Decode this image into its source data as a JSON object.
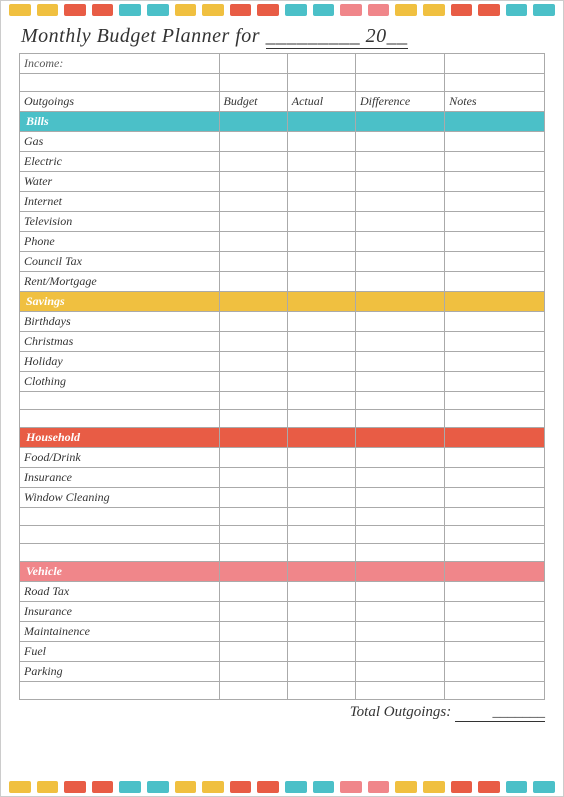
{
  "title": {
    "prefix": "Monthly Budget Planner for",
    "month_line": "_________ 20__"
  },
  "deco_colors_top": [
    "#f0c040",
    "#f0c040",
    "#e85c45",
    "#e85c45",
    "#4bc0c8",
    "#4bc0c8",
    "#f0c040",
    "#f0c040",
    "#e85c45",
    "#e85c45",
    "#4bc0c8",
    "#4bc0c8",
    "#f0868a",
    "#f0868a",
    "#f0c040",
    "#f0c040",
    "#e85c45",
    "#e85c45",
    "#4bc0c8",
    "#4bc0c8"
  ],
  "deco_colors_bottom": [
    "#f0c040",
    "#f0c040",
    "#e85c45",
    "#e85c45",
    "#4bc0c8",
    "#4bc0c8",
    "#f0c040",
    "#f0c040",
    "#e85c45",
    "#e85c45",
    "#4bc0c8",
    "#4bc0c8",
    "#f0868a",
    "#f0868a",
    "#f0c040",
    "#f0c040",
    "#e85c45",
    "#e85c45",
    "#4bc0c8",
    "#4bc0c8"
  ],
  "income_label": "Income:",
  "headers": {
    "outgoings": "Outgoings",
    "budget": "Budget",
    "actual": "Actual",
    "difference": "Difference",
    "notes": "Notes"
  },
  "sections": {
    "bills": {
      "label": "Bills",
      "items": [
        "Gas",
        "Electric",
        "Water",
        "Internet",
        "Television",
        "Phone",
        "Council Tax",
        "Rent/Mortgage"
      ]
    },
    "savings": {
      "label": "Savings",
      "items": [
        "Birthdays",
        "Christmas",
        "Holiday",
        "Clothing"
      ]
    },
    "household": {
      "label": "Household",
      "items": [
        "Food/Drink",
        "Insurance",
        "Window Cleaning"
      ]
    },
    "vehicle": {
      "label": "Vehicle",
      "items": [
        "Road Tax",
        "Insurance",
        "Maintainence",
        "Fuel",
        "Parking"
      ]
    }
  },
  "total_label": "Total Outgoings:",
  "total_line": "_______"
}
